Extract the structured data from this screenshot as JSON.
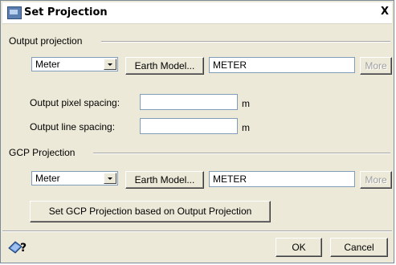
{
  "window": {
    "title": "Set Projection",
    "close_label": "X"
  },
  "output_projection": {
    "section_label": "Output projection",
    "units_selected": "Meter",
    "earth_model_button": "Earth Model...",
    "projection_value": "METER",
    "more_button": "More",
    "pixel_spacing_label": "Output pixel spacing:",
    "pixel_spacing_value": "",
    "pixel_spacing_unit": "m",
    "line_spacing_label": "Output line spacing:",
    "line_spacing_value": "",
    "line_spacing_unit": "m"
  },
  "gcp_projection": {
    "section_label": "GCP Projection",
    "units_selected": "Meter",
    "earth_model_button": "Earth Model...",
    "projection_value": "METER",
    "more_button": "More",
    "set_based_button": "Set GCP Projection based on Output Projection"
  },
  "footer": {
    "ok_label": "OK",
    "cancel_label": "Cancel",
    "help_icon": "help-pointer-icon"
  }
}
